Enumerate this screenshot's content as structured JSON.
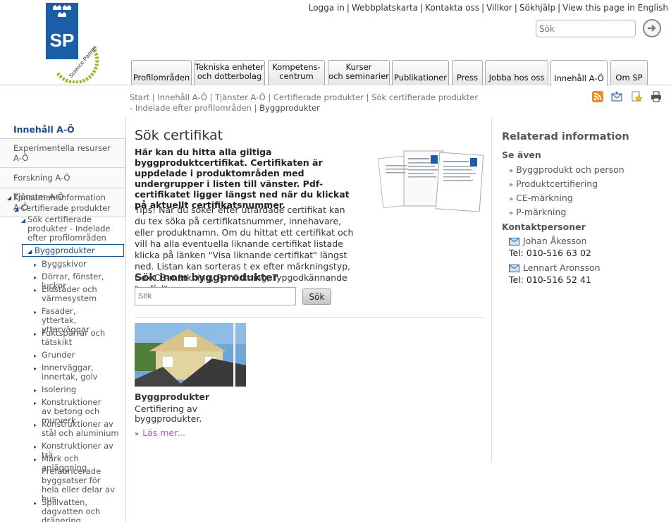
{
  "header": {
    "logo_text": "SP",
    "logo_tagline": "your Science Partner",
    "toplinks": [
      "Logga in",
      "Webbplatskarta",
      "Kontakta oss",
      "Villkor",
      "Sökhjälp",
      "View this page in English"
    ],
    "search_placeholder": "Sök",
    "tabs": [
      {
        "line1": "Profilområden",
        "line2": ""
      },
      {
        "line1": "Tekniska enheter",
        "line2": "och dotterbolag"
      },
      {
        "line1": "Kompetens-",
        "line2": "centrum"
      },
      {
        "line1": "Kurser",
        "line2": "och seminarier"
      },
      {
        "line1": "Publikationer",
        "line2": ""
      },
      {
        "line1": "Press",
        "line2": ""
      },
      {
        "line1": "Jobba hos oss",
        "line2": ""
      },
      {
        "line1": "Innehåll A-Ö",
        "line2": ""
      },
      {
        "line1": "Om SP",
        "line2": ""
      }
    ],
    "active_tab": "Innehåll A-Ö"
  },
  "breadcrumb": {
    "items": [
      "Start",
      "Innehåll A-Ö",
      "Tjänster A-Ö",
      "Certifierade produkter",
      "Sök certifierade produkter - Indelade efter profilområden"
    ],
    "current": "Byggprodukter",
    "separator": "|"
  },
  "leftnav": {
    "title": "Innehåll A-Ö",
    "boxes": [
      "Experimentella resurser A-Ö",
      "Forskning A-Ö",
      "Konsumentinformation A-Ö"
    ],
    "tree": {
      "root": "Tjänster A-Ö",
      "level1": "Certifierade produkter",
      "level2": "Sök certifierade produkter - Indelade efter profilområden",
      "selected": "Byggprodukter",
      "children": [
        "Byggskivor",
        "Dörrar, fönster, luckor",
        "Eldstäder och värmesystem",
        "Fasader, yttertak, ytterväggar",
        "Fuktspärrar och tätskikt",
        "Grunder",
        "Innerväggar, innertak, golv",
        "Isolering",
        "Konstruktioner av betong och murverk",
        "Konstruktioner av stål och aluminium",
        "Konstruktioner av trä",
        "Mark och anläggning",
        "Prefabricerade byggsatser för hela eller delar av hus",
        "Spillvatten, dagvatten och dränering"
      ]
    }
  },
  "main": {
    "title": "Sök certifikat",
    "lead": "Här kan du hitta alla giltiga byggproduktcertifikat. Certifikaten är uppdelade i produktområden med undergrupper i listen till vänster. Pdf-certifikatet ligger längst ned när du klickat på aktuellt certifikatsnummer.",
    "tips": "Tips! När du söker efter utfärdade certifikat kan du tex söka på certifikatsnummer, innehavare, eller produktnamn. Om du hittat ett certifikat och vill ha alla eventuella liknande certifikat listade klicka på länken \"Visa liknande certifikat\" längst ned. Listan kan sorteras t ex efter märkningstyp, t ex CE-märkning, P-märkning, Typgodkännande \"gaffel\".",
    "search_heading": "Sök inom byggprodukter",
    "search_placeholder": "Sök",
    "search_button": "Sök",
    "card": {
      "title": "Byggprodukter",
      "text": "Certifiering av byggprodukter.",
      "link": "Läs mer..."
    }
  },
  "right": {
    "heading": "Relaterad information",
    "see_also_label": "Se även",
    "see_also": [
      "Byggprodukt och person",
      "Produktcertifiering",
      "CE-märkning",
      "P-märkning"
    ],
    "contacts_label": "Kontaktpersoner",
    "contacts": [
      {
        "name": "Johan Åkesson",
        "phone": "Tel: 010-516 63 02"
      },
      {
        "name": "Lennart Aronsson",
        "phone": "Tel: 010-516 52 41"
      }
    ]
  },
  "colors": {
    "brand_blue": "#1b5ea8",
    "nav_blue": "#1b4a8a",
    "link_purple": "#b05ac8"
  }
}
